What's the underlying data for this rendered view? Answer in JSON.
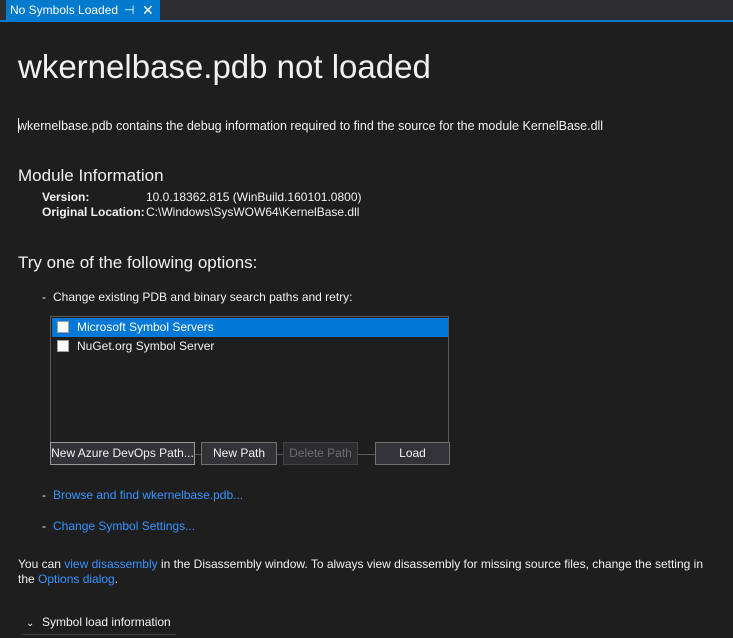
{
  "tab": {
    "title": "No Symbols Loaded",
    "pin_glyph": "⊣",
    "close_glyph": "✕"
  },
  "page": {
    "title": "wkernelbase.pdb not loaded",
    "description": "wkernelbase.pdb contains the debug information required to find the source for the module KernelBase.dll"
  },
  "module_info": {
    "heading": "Module Information",
    "version_label": "Version:",
    "version_value": "10.0.18362.815 (WinBuild.160101.0800)",
    "location_label": "Original Location:",
    "location_value": "C:\\Windows\\SysWOW64\\KernelBase.dll"
  },
  "options": {
    "heading": "Try one of the following options:",
    "dash": "-",
    "change_paths_text": "Change existing PDB and binary search paths and retry:",
    "symbol_servers": [
      {
        "label": "Microsoft Symbol Servers",
        "checked": false,
        "selected": true
      },
      {
        "label": "NuGet.org Symbol Server",
        "checked": false,
        "selected": false
      }
    ],
    "buttons": {
      "new_azure": "New Azure DevOps Path...",
      "new_path": "New Path",
      "delete_path": "Delete Path",
      "load": "Load"
    },
    "browse_link": "Browse and find wkernelbase.pdb...",
    "settings_link": "Change Symbol Settings..."
  },
  "disassembly": {
    "prefix": "You can ",
    "link": "view disassembly",
    "middle": " in the Disassembly window. To always view disassembly for missing source files, change the setting in the ",
    "options_link": "Options dialog",
    "suffix": "."
  },
  "symbol_load": {
    "chevron_icon": "chevron-down-icon",
    "chevron_glyph": "⌄",
    "label": "Symbol load information"
  },
  "colors": {
    "accent": "#007acc",
    "link": "#3794ff",
    "selection": "#0078d7",
    "background": "#1e1e1e"
  }
}
